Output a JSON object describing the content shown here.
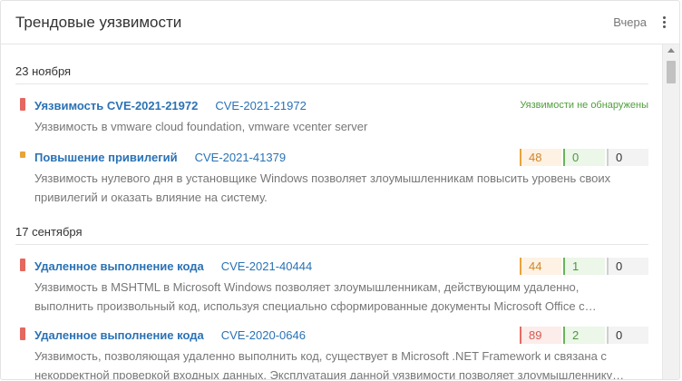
{
  "header": {
    "title": "Трендовые уязвимости",
    "period": "Вчера"
  },
  "colors": {
    "link": "#2a72b5",
    "severity_high": "#e5675f",
    "severity_medium": "#e8a33b",
    "ok_green": "#4f9e3b"
  },
  "groups": [
    {
      "date": "23 ноября",
      "items": [
        {
          "name": "Уязвимость CVE-2021-21972",
          "cve": "CVE-2021-21972",
          "status": "Уязвимости не обнаружены",
          "desc1": "Уязвимость в vmware cloud foundation, vmware vcenter server",
          "severity": "high"
        },
        {
          "name": "Повышение привилегий",
          "cve": "CVE-2021-41379",
          "counts": [
            "48",
            "0",
            "0"
          ],
          "desc1": "Уязвимость нулевого дня в установщике Windows позволяет злоумышленникам повысить уровень своих",
          "desc2": "привилегий и оказать влияние на систему.",
          "severity": "medium"
        }
      ]
    },
    {
      "date": "17 сентября",
      "items": [
        {
          "name": "Удаленное выполнение кода",
          "cve": "CVE-2021-40444",
          "counts": [
            "44",
            "1",
            "0"
          ],
          "desc1": "Уязвимость в MSHTML в Microsoft Windows позволяет злоумышленникам, действующим удаленно,",
          "desc2": "выполнить произвольный код, используя специально сформированные документы Microsoft Office с…",
          "severity": "high"
        },
        {
          "name": "Удаленное выполнение кода",
          "cve": "CVE-2020-0646",
          "counts": [
            "89",
            "2",
            "0"
          ],
          "desc1": "Уязвимость, позволяющая удаленно выполнить код, существует в Microsoft .NET Framework и связана с",
          "desc2": "некорректной проверкой входных данных. Эксплуатация данной уязвимости позволяет злоумышленнику…",
          "severity": "high"
        }
      ]
    }
  ]
}
